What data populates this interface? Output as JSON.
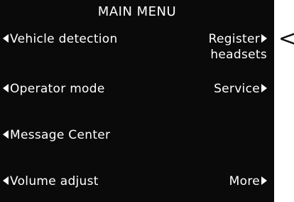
{
  "title": "MAIN MENU",
  "menu": {
    "vehicle_detection": "Vehicle detection",
    "register_headsets_line1": "Register",
    "register_headsets_line2": "headsets",
    "operator_mode": "Operator mode",
    "service": "Service",
    "message_center": "Message Center",
    "volume_adjust": "Volume adjust",
    "more": "More"
  },
  "pointer_glyph": "<",
  "colors": {
    "screen_bg": "#0a0a0a",
    "text": "#ffffff",
    "page_bg": "#ffffff"
  },
  "icons": {
    "left_arrow": "left-triangle-icon",
    "right_arrow": "right-triangle-icon"
  }
}
